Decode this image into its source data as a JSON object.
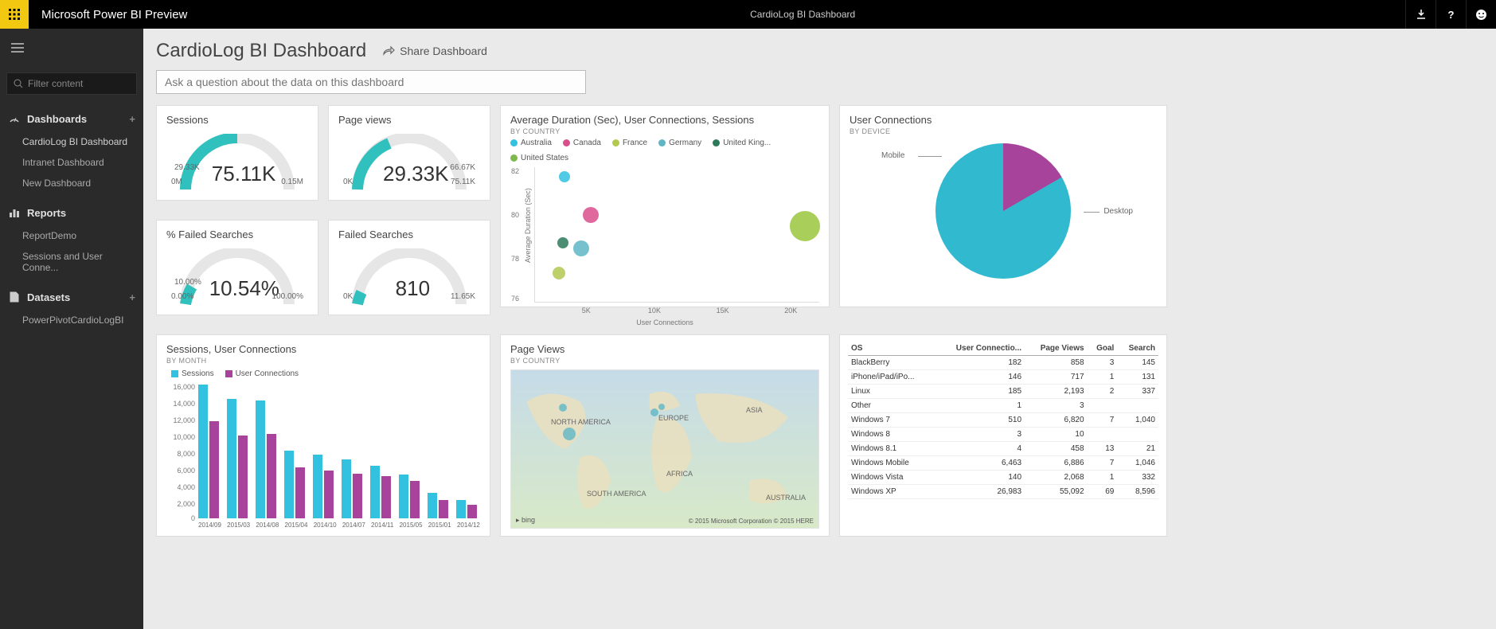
{
  "topbar": {
    "app_title": "Microsoft Power BI Preview",
    "center_title": "CardioLog BI Dashboard"
  },
  "leftnav": {
    "filter_placeholder": "Filter content",
    "dashboards_label": "Dashboards",
    "dashboards_items": [
      "CardioLog BI Dashboard",
      "Intranet Dashboard",
      "New Dashboard"
    ],
    "reports_label": "Reports",
    "reports_items": [
      "ReportDemo",
      "Sessions and User Conne..."
    ],
    "datasets_label": "Datasets",
    "datasets_items": [
      "PowerPivotCardioLogBI"
    ]
  },
  "header": {
    "title": "CardioLog BI Dashboard",
    "share_label": "Share Dashboard",
    "qa_placeholder": "Ask a question about the data on this dashboard"
  },
  "gauges": {
    "sessions": {
      "title": "Sessions",
      "value": "75.11K",
      "left": "0M",
      "right": "0.15M",
      "mid": "29.33K",
      "pct": 0.5
    },
    "pageviews": {
      "title": "Page views",
      "value": "29.33K",
      "left": "0K",
      "right": "75.11K",
      "mid": "66.67K",
      "pct": 0.39
    },
    "failedpct": {
      "title": "% Failed Searches",
      "value": "10.54%",
      "left": "0.00%",
      "right": "100.00%",
      "mid": "10.00%",
      "pct": 0.11
    },
    "failed": {
      "title": "Failed Searches",
      "value": "810",
      "left": "0K",
      "right": "11.65K",
      "pct": 0.07
    }
  },
  "scatter": {
    "title": "Average Duration (Sec), User Connections, Sessions",
    "sub": "BY COUNTRY",
    "countries": [
      "Australia",
      "Canada",
      "France",
      "Germany",
      "United King...",
      "United States"
    ],
    "colors": [
      "#33c1e0",
      "#d94f8c",
      "#b3c84f",
      "#5fb6c5",
      "#2c7a5a",
      "#7fb84f"
    ],
    "ylabel": "Average Duration (Sec)",
    "xlabel": "User Connections",
    "yticks": [
      "82",
      "80",
      "78",
      "76"
    ],
    "xticks": [
      "5K",
      "10K",
      "15K",
      "20K"
    ]
  },
  "pie": {
    "title": "User Connections",
    "sub": "BY DEVICE",
    "labels": {
      "mobile": "Mobile",
      "desktop": "Desktop"
    }
  },
  "barchart": {
    "title": "Sessions, User Connections",
    "sub": "BY MONTH",
    "legend": [
      "Sessions",
      "User Connections"
    ],
    "yticks": [
      "16,000",
      "14,000",
      "12,000",
      "10,000",
      "8,000",
      "6,000",
      "4,000",
      "2,000",
      "0"
    ],
    "xticks": [
      "2014/09",
      "2015/03",
      "2014/08",
      "2015/04",
      "2014/10",
      "2014/07",
      "2014/11",
      "2015/05",
      "2015/01",
      "2014/12"
    ]
  },
  "map": {
    "title": "Page Views",
    "sub": "BY COUNTRY",
    "continents": [
      "NORTH AMERICA",
      "SOUTH AMERICA",
      "EUROPE",
      "AFRICA",
      "ASIA",
      "AUSTRALIA"
    ],
    "bing": "bing",
    "copyright": "© 2015 Microsoft Corporation    © 2015 HERE"
  },
  "table": {
    "headers": [
      "OS",
      "User Connectio...",
      "Page Views",
      "Goal",
      "Search"
    ],
    "rows": [
      [
        "BlackBerry",
        "182",
        "858",
        "3",
        "145"
      ],
      [
        "iPhone/iPad/iPo...",
        "146",
        "717",
        "1",
        "131"
      ],
      [
        "Linux",
        "185",
        "2,193",
        "2",
        "337"
      ],
      [
        "Other",
        "1",
        "3",
        "",
        ""
      ],
      [
        "Windows 7",
        "510",
        "6,820",
        "7",
        "1,040"
      ],
      [
        "Windows 8",
        "3",
        "10",
        "",
        ""
      ],
      [
        "Windows 8.1",
        "4",
        "458",
        "13",
        "21"
      ],
      [
        "Windows Mobile",
        "6,463",
        "6,886",
        "7",
        "1,046"
      ],
      [
        "Windows Vista",
        "140",
        "2,068",
        "1",
        "332"
      ],
      [
        "Windows XP",
        "26,983",
        "55,092",
        "69",
        "8,596"
      ]
    ]
  },
  "chart_data": [
    {
      "type": "bar",
      "title": "Sessions, User Connections BY MONTH",
      "categories": [
        "2014/09",
        "2015/03",
        "2014/08",
        "2015/04",
        "2014/10",
        "2014/07",
        "2014/11",
        "2015/05",
        "2015/01",
        "2014/12"
      ],
      "series": [
        {
          "name": "Sessions",
          "values": [
            15800,
            14200,
            14000,
            8000,
            7500,
            7000,
            6200,
            5200,
            3000,
            2200
          ]
        },
        {
          "name": "User Connections",
          "values": [
            11500,
            9800,
            10000,
            6000,
            5600,
            5200,
            5000,
            4400,
            2200,
            1600
          ]
        }
      ],
      "ylim": [
        0,
        16000
      ]
    },
    {
      "type": "scatter",
      "title": "Average Duration (Sec), User Connections, Sessions BY COUNTRY",
      "xlabel": "User Connections",
      "ylabel": "Average Duration (Sec)",
      "series": [
        {
          "name": "Australia",
          "x": 5200,
          "y": 82.6,
          "size": 10
        },
        {
          "name": "Canada",
          "x": 6500,
          "y": 80.0,
          "size": 14
        },
        {
          "name": "France",
          "x": 4900,
          "y": 77.2,
          "size": 12
        },
        {
          "name": "Germany",
          "x": 5000,
          "y": 78.6,
          "size": 10
        },
        {
          "name": "United Kingdom",
          "x": 5700,
          "y": 78.4,
          "size": 14
        },
        {
          "name": "United States",
          "x": 20000,
          "y": 79.6,
          "size": 26
        }
      ],
      "xlim": [
        4000,
        21000
      ],
      "ylim": [
        76,
        83
      ]
    },
    {
      "type": "pie",
      "title": "User Connections BY DEVICE",
      "categories": [
        "Mobile",
        "Desktop"
      ],
      "values": [
        17,
        83
      ]
    },
    {
      "type": "table",
      "title": "OS table",
      "headers": [
        "OS",
        "User Connections",
        "Page Views",
        "Goal",
        "Search"
      ],
      "rows": [
        [
          "BlackBerry",
          182,
          858,
          3,
          145
        ],
        [
          "iPhone/iPad/iPod",
          146,
          717,
          1,
          131
        ],
        [
          "Linux",
          185,
          2193,
          2,
          337
        ],
        [
          "Other",
          1,
          3,
          null,
          null
        ],
        [
          "Windows 7",
          510,
          6820,
          7,
          1040
        ],
        [
          "Windows 8",
          3,
          10,
          null,
          null
        ],
        [
          "Windows 8.1",
          4,
          458,
          13,
          21
        ],
        [
          "Windows Mobile",
          6463,
          6886,
          7,
          1046
        ],
        [
          "Windows Vista",
          140,
          2068,
          1,
          332
        ],
        [
          "Windows XP",
          26983,
          55092,
          69,
          8596
        ]
      ]
    }
  ]
}
